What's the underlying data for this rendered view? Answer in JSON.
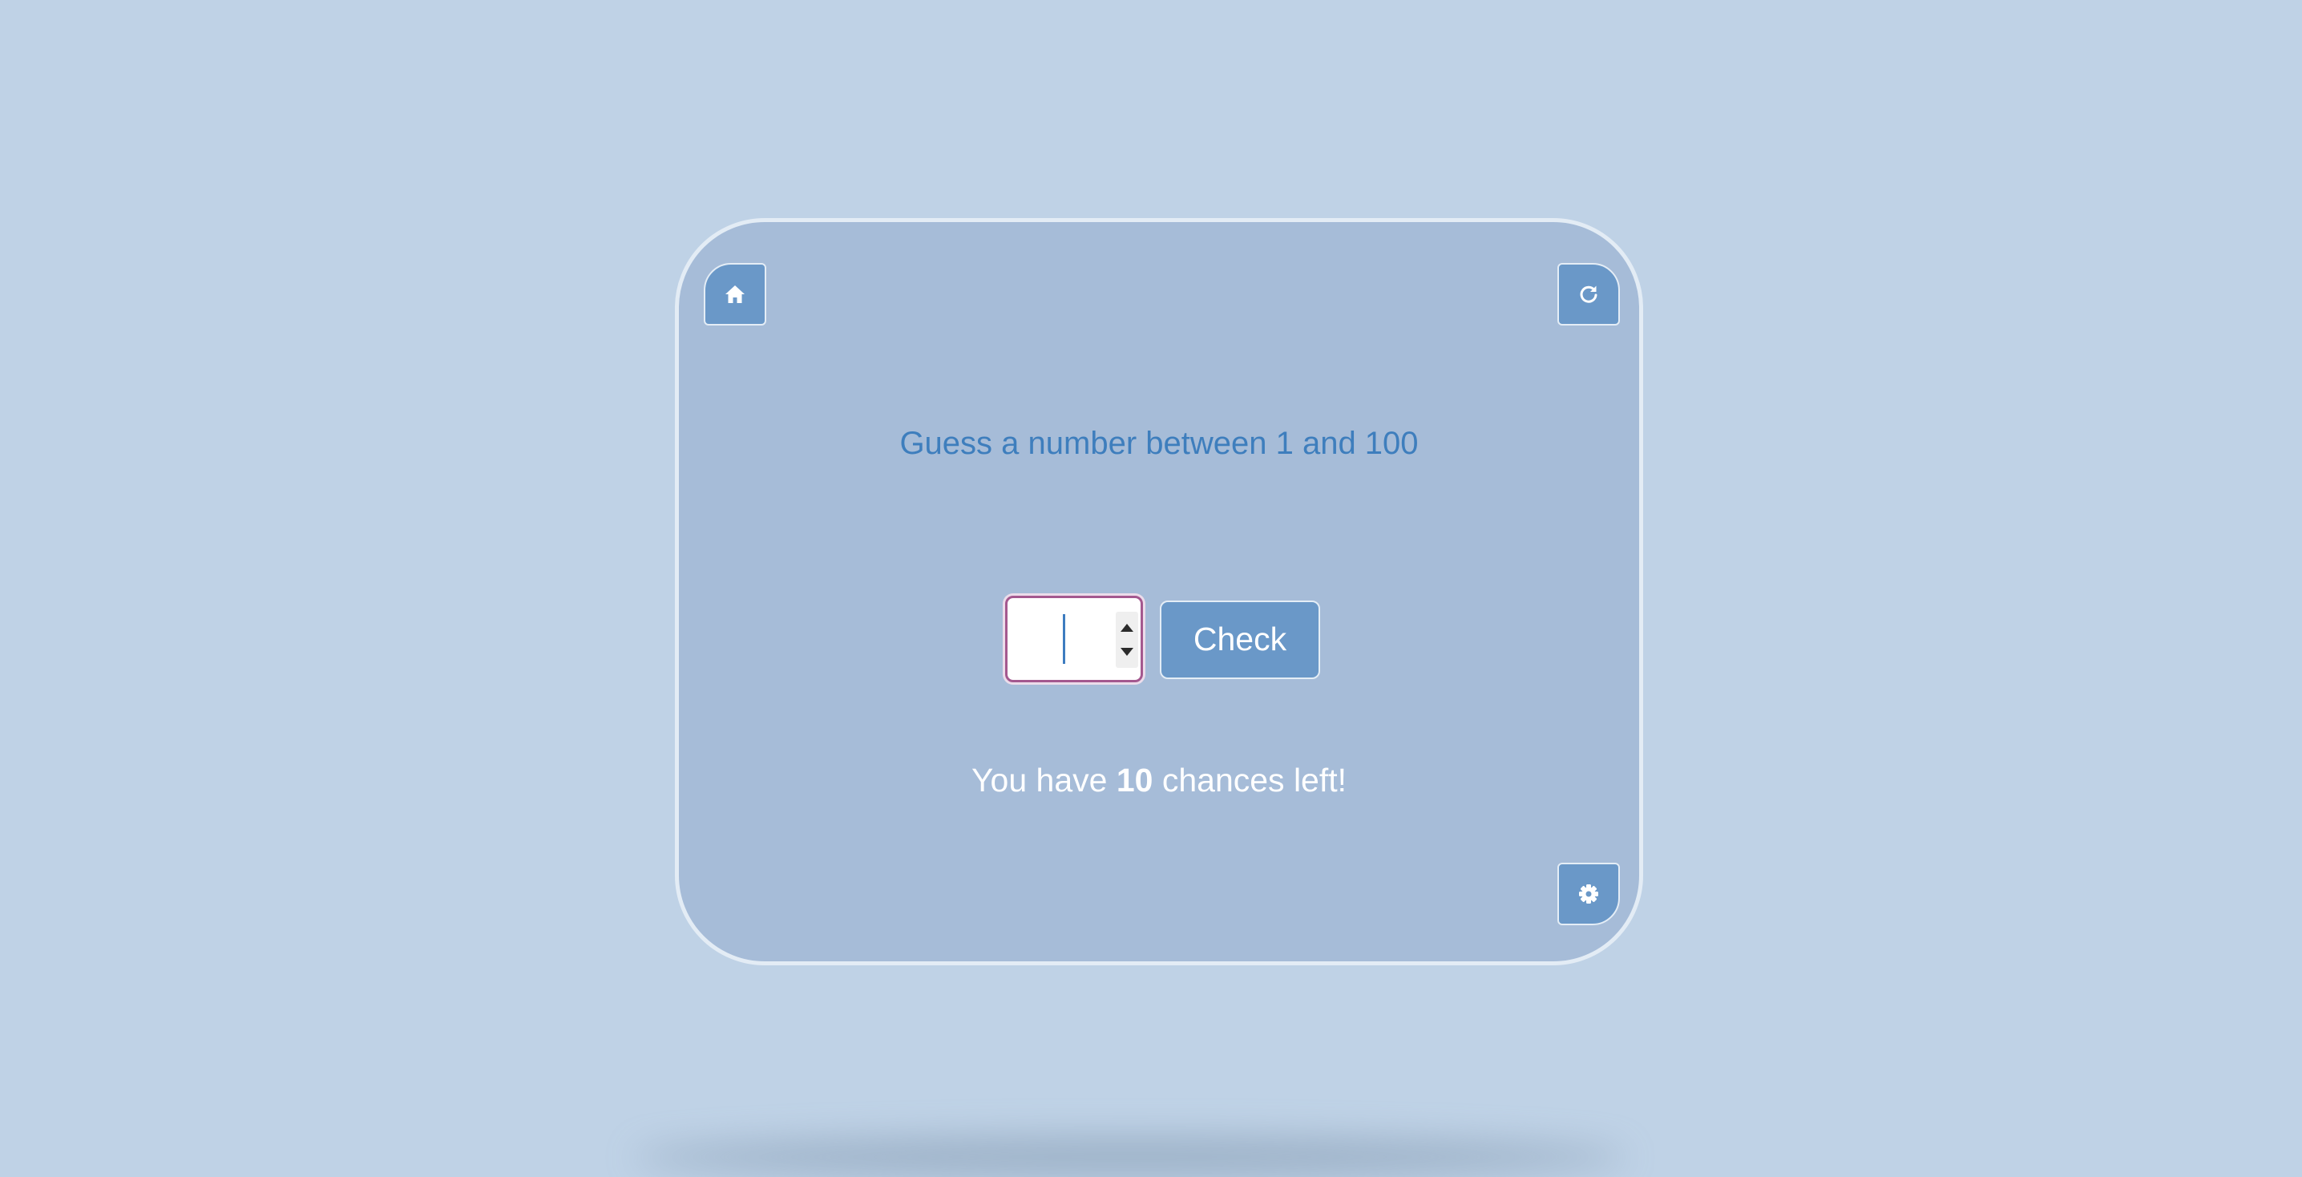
{
  "app": {
    "prompt": "Guess a number between 1 and 100",
    "guess_input": {
      "value": "",
      "placeholder": ""
    },
    "check_label": "Check",
    "chances": {
      "prefix": "You have ",
      "count": "10",
      "suffix": " chances left!"
    }
  },
  "icons": {
    "home": "home-icon",
    "restart": "restart-icon",
    "settings": "gear-icon",
    "spin_up": "caret-up-icon",
    "spin_down": "caret-down-icon"
  },
  "colors": {
    "page_background": "#bfd2e6",
    "card_background": "#a6bcd8",
    "card_border": "#e3ecf5",
    "button_background": "#6a98c8",
    "prompt_text": "#3e7ebd",
    "input_focus_border": "#a4588f",
    "chances_text": "#ffffff"
  }
}
